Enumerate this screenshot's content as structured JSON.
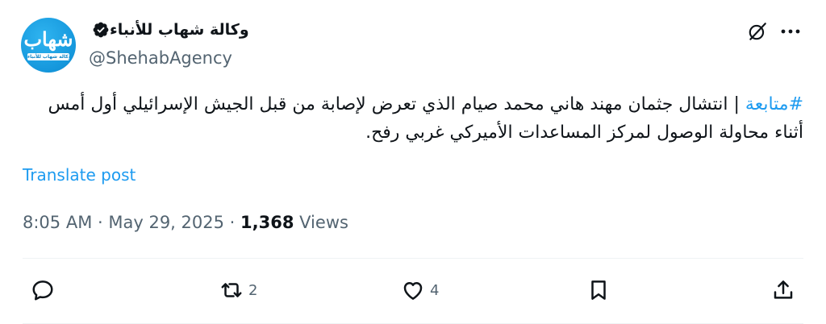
{
  "account": {
    "display_name": "وكالة شهاب للأنباء",
    "handle": "@ShehabAgency",
    "verified": true,
    "avatar_mark": "شهاب",
    "avatar_caption": "وكالة شهاب للأنباء"
  },
  "tweet": {
    "hashtag": "#متابعة",
    "line1": " | انتشال جثمان مهند هاني محمد صيام الذي تعرض لإصابة من قبل الجيش الإسرائيلي أول أمس",
    "line2": "أثناء محاولة الوصول لمركز المساعدات الأميركي غربي رفح.",
    "translate_label": "Translate post",
    "time": "8:05 AM",
    "date": "May 29, 2025",
    "views_count": "1,368",
    "views_label": "Views"
  },
  "actions": {
    "reply_count": "",
    "retweet_count": "2",
    "like_count": "4"
  },
  "icons": {
    "grok": "grok-icon",
    "more": "more-icon",
    "verified": "verified-badge-icon",
    "reply": "reply-icon",
    "retweet": "retweet-icon",
    "like": "heart-icon",
    "bookmark": "bookmark-icon",
    "share": "share-icon"
  },
  "colors": {
    "accent": "#1d9bf0",
    "secondary_text": "#536471",
    "primary_text": "#0f1419",
    "avatar_bg": "#1597dc"
  }
}
